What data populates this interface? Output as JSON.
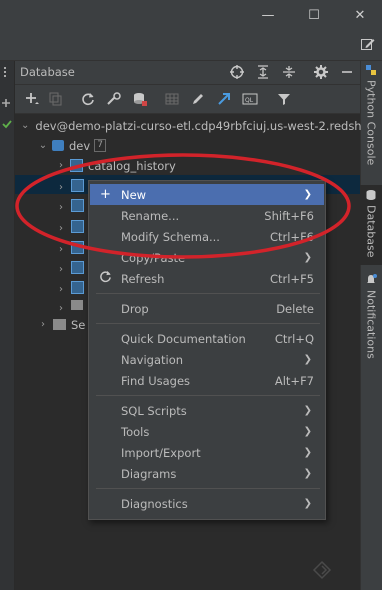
{
  "window": {
    "minimize_glyph": "—",
    "maximize_glyph": "☐",
    "close_glyph": "✕"
  },
  "panel": {
    "title": "Database"
  },
  "right_tabs": [
    {
      "label": "Python Console"
    },
    {
      "label": "Database"
    },
    {
      "label": "Notifications"
    }
  ],
  "tree": {
    "connection": "dev@demo-platzi-curso-etl.cdp49rbfciuj.us-west-2.redsh",
    "database": "dev",
    "database_count": "7",
    "first_schema": "catalog_history",
    "last_item_prefix": "Se"
  },
  "menu": {
    "items": [
      {
        "label": "New",
        "shortcut": "",
        "submenu": true,
        "selected": true,
        "icon": "plus-icon"
      },
      {
        "label": "Rename...",
        "shortcut": "Shift+F6",
        "submenu": false
      },
      {
        "label": "Modify Schema...",
        "shortcut": "Ctrl+F6",
        "submenu": false
      },
      {
        "label": "Copy/Paste",
        "shortcut": "",
        "submenu": true
      },
      {
        "label": "Refresh",
        "shortcut": "Ctrl+F5",
        "submenu": false,
        "icon": "refresh-icon"
      },
      {
        "label": "Drop",
        "shortcut": "Delete",
        "submenu": false
      },
      {
        "label": "Quick Documentation",
        "shortcut": "Ctrl+Q",
        "submenu": false
      },
      {
        "label": "Navigation",
        "shortcut": "",
        "submenu": true
      },
      {
        "label": "Find Usages",
        "shortcut": "Alt+F7",
        "submenu": false
      },
      {
        "label": "SQL Scripts",
        "shortcut": "",
        "submenu": true
      },
      {
        "label": "Tools",
        "shortcut": "",
        "submenu": true
      },
      {
        "label": "Import/Export",
        "shortcut": "",
        "submenu": true
      },
      {
        "label": "Diagrams",
        "shortcut": "",
        "submenu": true
      },
      {
        "label": "Diagnostics",
        "shortcut": "",
        "submenu": true
      }
    ]
  },
  "colors": {
    "background": "#2b2b2b",
    "panel": "#3c3f41",
    "selection": "#4b6eaf",
    "annotation": "#d2232a"
  }
}
